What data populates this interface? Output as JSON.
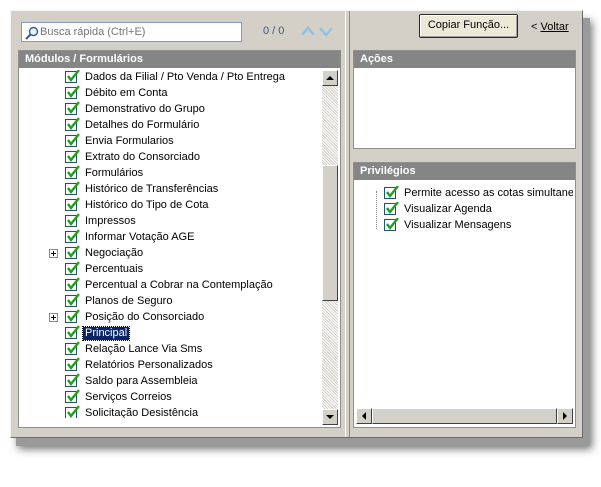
{
  "search": {
    "placeholder": "Busca rápida (Ctrl+E)",
    "counter": "0 / 0"
  },
  "toolbar": {
    "copy_label": "Copiar Função...",
    "back_prefix": "< ",
    "back_label": "Voltar"
  },
  "modules_panel": {
    "title": "Módulos / Formulários",
    "items": [
      {
        "label": "Dados da Filial / Pto Venda / Pto Entrega",
        "checked": true,
        "expandable": false,
        "selected": false
      },
      {
        "label": "Débito em Conta",
        "checked": true,
        "expandable": false,
        "selected": false
      },
      {
        "label": "Demonstrativo do Grupo",
        "checked": true,
        "expandable": false,
        "selected": false
      },
      {
        "label": "Detalhes do Formulário",
        "checked": true,
        "expandable": false,
        "selected": false
      },
      {
        "label": "Envia Formularios",
        "checked": true,
        "expandable": false,
        "selected": false
      },
      {
        "label": "Extrato do Consorciado",
        "checked": true,
        "expandable": false,
        "selected": false
      },
      {
        "label": "Formulários",
        "checked": true,
        "expandable": false,
        "selected": false
      },
      {
        "label": "Histórico de Transferências",
        "checked": true,
        "expandable": false,
        "selected": false
      },
      {
        "label": "Histórico do Tipo de Cota",
        "checked": true,
        "expandable": false,
        "selected": false
      },
      {
        "label": "Impressos",
        "checked": true,
        "expandable": false,
        "selected": false
      },
      {
        "label": "Informar Votação AGE",
        "checked": true,
        "expandable": false,
        "selected": false
      },
      {
        "label": "Negociação",
        "checked": true,
        "expandable": true,
        "selected": false
      },
      {
        "label": "Percentuais",
        "checked": true,
        "expandable": false,
        "selected": false
      },
      {
        "label": "Percentual a Cobrar na Contemplação",
        "checked": true,
        "expandable": false,
        "selected": false
      },
      {
        "label": "Planos de Seguro",
        "checked": true,
        "expandable": false,
        "selected": false
      },
      {
        "label": "Posição do Consorciado",
        "checked": true,
        "expandable": true,
        "selected": false
      },
      {
        "label": "Principal",
        "checked": true,
        "expandable": false,
        "selected": true
      },
      {
        "label": "Relação Lance Via Sms",
        "checked": true,
        "expandable": false,
        "selected": false
      },
      {
        "label": "Relatórios Personalizados",
        "checked": true,
        "expandable": false,
        "selected": false
      },
      {
        "label": "Saldo para Assembleia",
        "checked": true,
        "expandable": false,
        "selected": false
      },
      {
        "label": "Serviços Correios",
        "checked": true,
        "expandable": false,
        "selected": false
      },
      {
        "label": "Solicitação Desistência",
        "checked": true,
        "expandable": false,
        "selected": false
      }
    ]
  },
  "actions_panel": {
    "title": "Ações"
  },
  "privileges_panel": {
    "title": "Privilégios",
    "items": [
      {
        "label": "Permite acesso as cotas simultaneamente",
        "checked": true
      },
      {
        "label": "Visualizar Agenda",
        "checked": true
      },
      {
        "label": "Visualizar Mensagens",
        "checked": true
      }
    ]
  },
  "colors": {
    "header_bg": "#858585",
    "window_bg": "#d4d0c8",
    "selection_bg": "#0a246a",
    "check_color": "#21a121"
  }
}
